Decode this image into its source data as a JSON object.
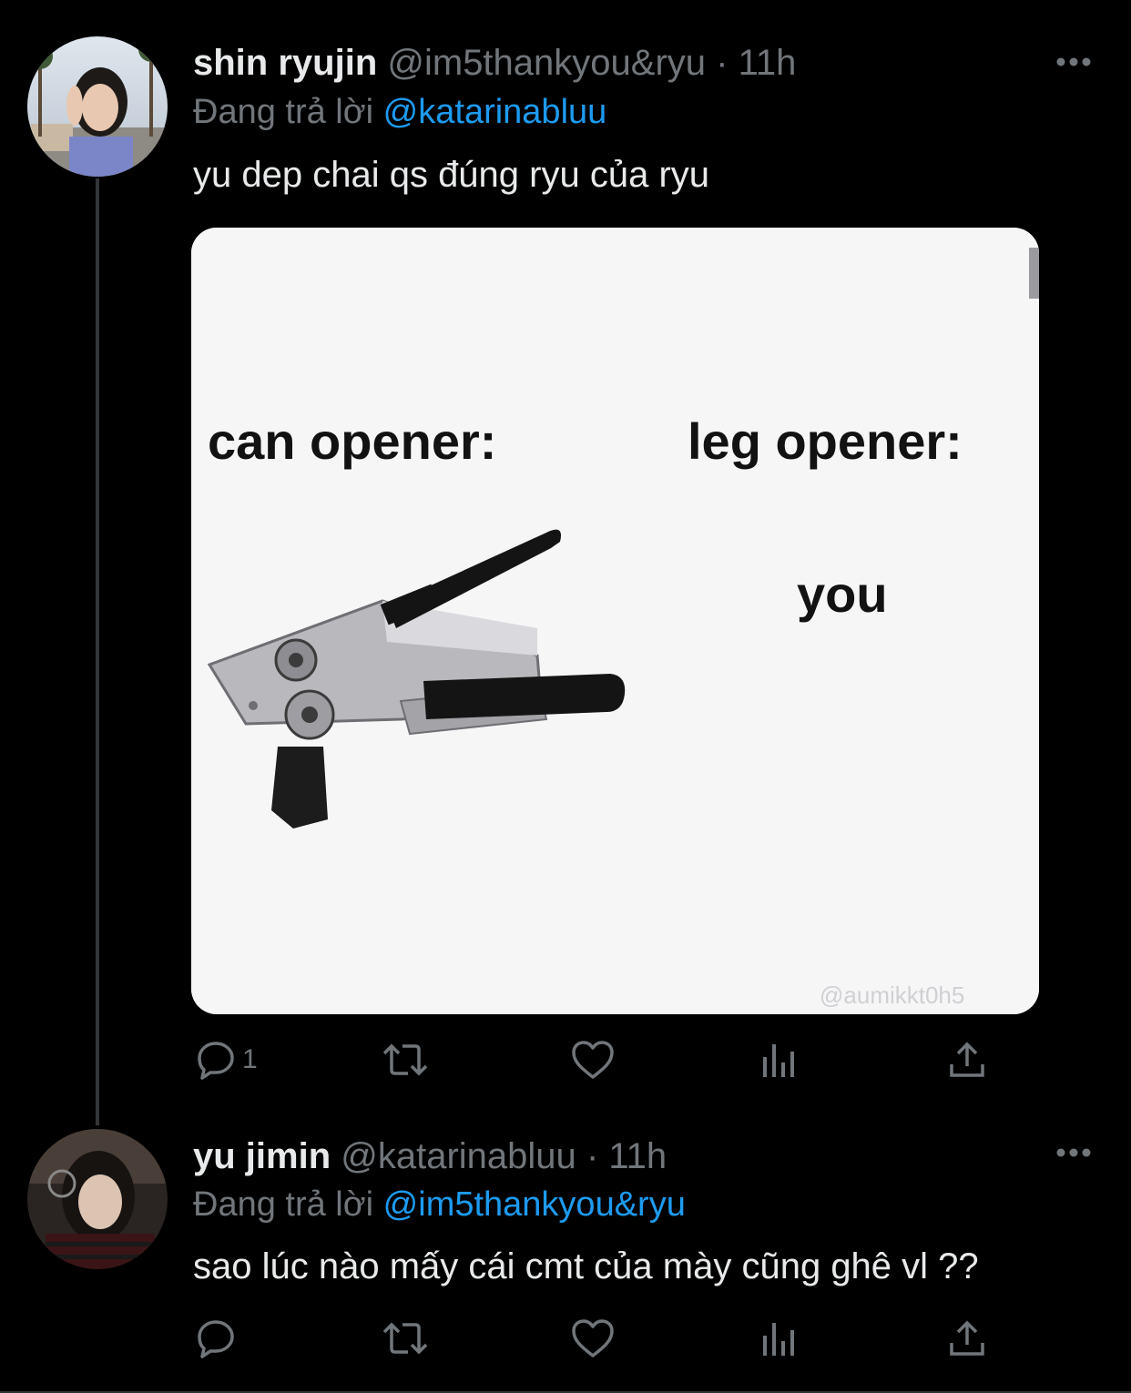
{
  "tweets": [
    {
      "author_name": "shin ryujin",
      "handle": "@im5thankyou&ryu",
      "separator": "·",
      "time": "11h",
      "replying_prefix": "Đang trả lời",
      "replying_to": "@katarinabluu",
      "text": "yu dep chai qs đúng ryu của ryu",
      "media": {
        "left_caption": "can opener:",
        "right_caption": "leg opener:",
        "you_caption": "you",
        "watermark": "@aumikkt0h5"
      },
      "reply_count": "1",
      "icons": [
        "reply-icon",
        "retweet-icon",
        "like-icon",
        "analytics-icon",
        "share-icon",
        "more-icon"
      ]
    },
    {
      "author_name": "yu jimin",
      "handle": "@katarinabluu",
      "separator": "·",
      "time": "11h",
      "replying_prefix": "Đang trả lời",
      "replying_to": "@im5thankyou&ryu",
      "text": "sao lúc nào mấy cái cmt của mày cũng ghê vl ??",
      "icons": [
        "reply-icon",
        "retweet-icon",
        "like-icon",
        "analytics-icon",
        "share-icon",
        "more-icon"
      ]
    }
  ],
  "colors": {
    "background": "#000000",
    "primary_text": "#e7e9ea",
    "secondary_text": "#71767b",
    "accent": "#1d9bf0",
    "divider": "#2f3336"
  }
}
